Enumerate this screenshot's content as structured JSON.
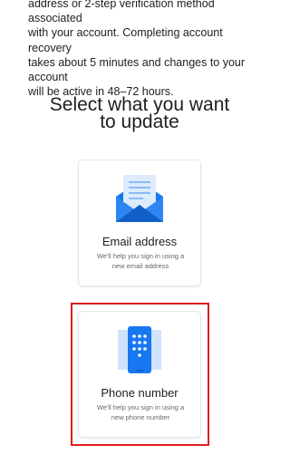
{
  "intro": {
    "line1": "address or 2-step verification method associated",
    "line2": "with your account. Completing account recovery",
    "line3": "takes about 5 minutes and changes to your account",
    "line4": "will be active in 48–72 hours."
  },
  "heading": {
    "line1": "Select what you want",
    "line2": "to update"
  },
  "options": {
    "email": {
      "title": "Email address",
      "sub_line1": "We'll help you sign in using a",
      "sub_line2": "new email address",
      "icon": "envelope-icon"
    },
    "phone": {
      "title": "Phone number",
      "sub_line1": "We'll help you sign in using a",
      "sub_line2": "new phone number",
      "icon": "phone-keypad-icon"
    }
  },
  "colors": {
    "accent": "#1877f2",
    "highlight": "#e11d1d"
  }
}
